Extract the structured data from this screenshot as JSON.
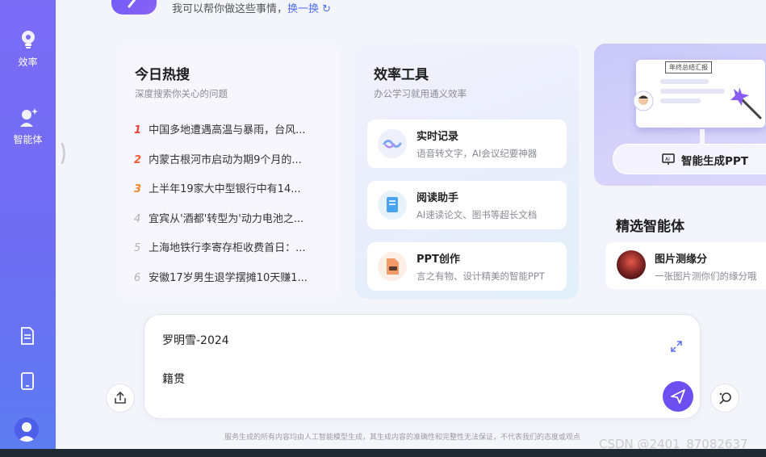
{
  "header": {
    "subtitle": "我可以帮你做这些事情，",
    "refresh_label": "换一换"
  },
  "sidebar": {
    "items": [
      {
        "label": "效率",
        "icon": "lightbulb-icon"
      },
      {
        "label": "智能体",
        "icon": "agent-icon"
      }
    ],
    "bottom_icons": [
      "document-icon",
      "tablet-icon",
      "user-avatar-icon"
    ]
  },
  "hot": {
    "title": "今日热搜",
    "subtitle": "深度搜索你关心的问题",
    "items": [
      {
        "rank": "1",
        "text": "中国多地遭遇高温与暴雨，台风..."
      },
      {
        "rank": "2",
        "text": "内蒙古根河市启动为期9个月的..."
      },
      {
        "rank": "3",
        "text": "上半年19家大中型银行中有14..."
      },
      {
        "rank": "4",
        "text": "宜宾从'酒都'转型为'动力电池之..."
      },
      {
        "rank": "5",
        "text": "上海地铁行李寄存柜收费首日：..."
      },
      {
        "rank": "6",
        "text": "安徽17岁男生退学摆摊10天赚1..."
      }
    ]
  },
  "tools": {
    "title": "效率工具",
    "subtitle": "办公学习就用通义效率",
    "items": [
      {
        "name": "实时记录",
        "desc": "语音转文字，AI会议纪要神器"
      },
      {
        "name": "阅读助手",
        "desc": "AI速读论文、图书等超长文档"
      },
      {
        "name": "PPT创作",
        "desc": "言之有物、设计精美的智能PPT"
      }
    ]
  },
  "ppt": {
    "board_tag": "年终总结汇报",
    "button_label": "智能生成PPT"
  },
  "agents": {
    "title": "精选智能体",
    "items": [
      {
        "name": "图片测缘分",
        "desc": "一张图片测你们的缘分哦"
      }
    ]
  },
  "input": {
    "value": "罗明雪-2024\n\n籍贯"
  },
  "footer": {
    "disclaimer": "服务生成的所有内容均由人工智能模型生成，其生成内容的准确性和完整性无法保证，不代表我们的态度或观点",
    "watermark": "CSDN @2401_87082637"
  },
  "colors": {
    "accent": "#6b4ff0",
    "sidebar_top": "#7b6cf6",
    "sidebar_bottom": "#5d7cf2",
    "link": "#4f6ef7"
  }
}
